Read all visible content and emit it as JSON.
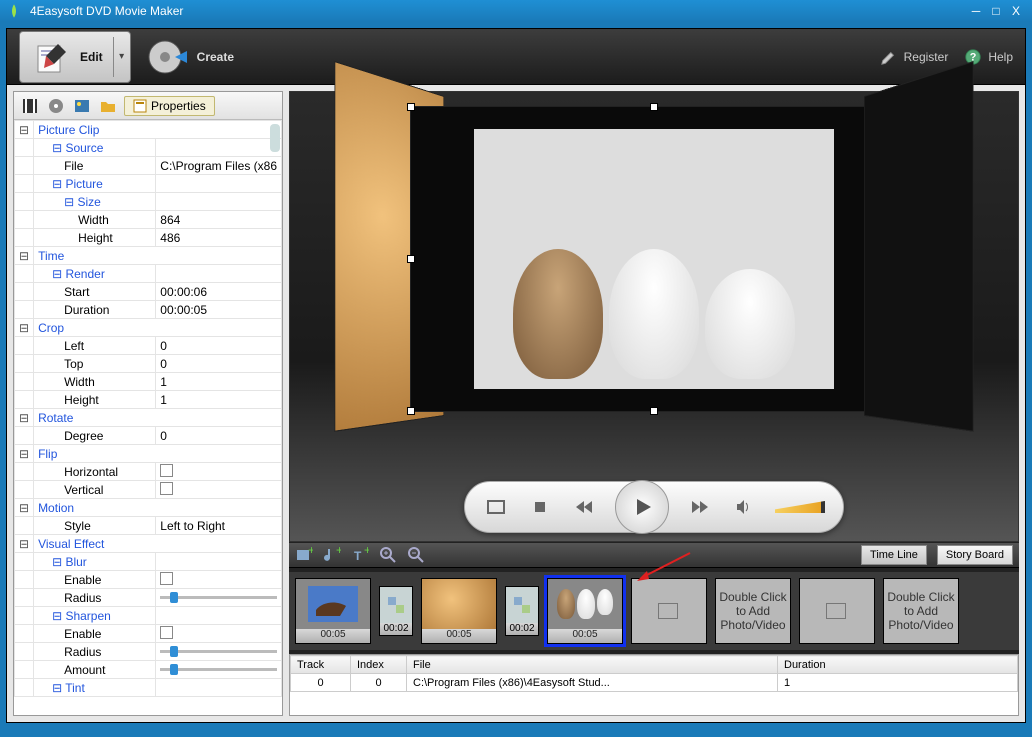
{
  "window": {
    "title": "4Easysoft DVD Movie Maker"
  },
  "topbar": {
    "edit": "Edit",
    "create": "Create",
    "register": "Register",
    "help": "Help"
  },
  "propTabs": {
    "properties": "Properties"
  },
  "props": {
    "picture_clip": "Picture Clip",
    "source": "Source",
    "file": "File",
    "file_val": "C:\\Program Files (x86",
    "picture": "Picture",
    "size": "Size",
    "width": "Width",
    "width_val": "864",
    "height": "Height",
    "height_val": "486",
    "time": "Time",
    "render": "Render",
    "start": "Start",
    "start_val": "00:00:06",
    "duration": "Duration",
    "duration_val": "00:00:05",
    "crop": "Crop",
    "left": "Left",
    "left_val": "0",
    "top": "Top",
    "top_val": "0",
    "cwidth": "Width",
    "cwidth_val": "1",
    "cheight": "Height",
    "cheight_val": "1",
    "rotate": "Rotate",
    "degree": "Degree",
    "degree_val": "0",
    "flip": "Flip",
    "horizontal": "Horizontal",
    "vertical": "Vertical",
    "motion": "Motion",
    "style": "Style",
    "style_val": "Left to Right",
    "vfx": "Visual Effect",
    "blur": "Blur",
    "enable": "Enable",
    "radius": "Radius",
    "sharpen": "Sharpen",
    "amount": "Amount",
    "tint": "Tint"
  },
  "toolbar2": {
    "timeline": "Time Line",
    "storyboard": "Story Board"
  },
  "timeline": {
    "clips": [
      {
        "dur": "00:05",
        "kind": "eagle"
      },
      {
        "dur": "00:02",
        "kind": "trans"
      },
      {
        "dur": "00:05",
        "kind": "dog"
      },
      {
        "dur": "00:02",
        "kind": "trans"
      },
      {
        "dur": "00:05",
        "kind": "cats",
        "selected": true
      }
    ],
    "add_label": "Double Click to Add Photo/Video"
  },
  "tracktable": {
    "headers": {
      "track": "Track",
      "index": "Index",
      "file": "File",
      "duration": "Duration"
    },
    "row": {
      "track": "0",
      "index": "0",
      "file": "C:\\Program Files (x86)\\4Easysoft Stud...",
      "duration": "1"
    }
  }
}
